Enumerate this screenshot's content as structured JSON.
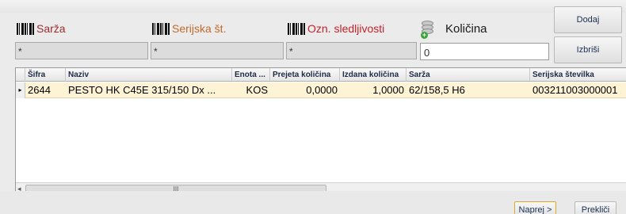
{
  "labels": {
    "sarza": "Sarža",
    "serijska": "Serijska št.",
    "ozn": "Ozn. sledljivosti",
    "kolicina": "Količina"
  },
  "filters": {
    "sarza": "*",
    "serijska": "*",
    "ozn": "*",
    "kolicina": "0"
  },
  "buttons": {
    "dodaj": "Dodaj",
    "izbrisi": "Izbriši",
    "naprej": "Naprej >",
    "preklici": "Prekliči"
  },
  "grid": {
    "columns": [
      "Šifra",
      "Naziv",
      "Enota ...",
      "Prejeta količina",
      "Izdana količina",
      "Sarža",
      "Serijska številka"
    ],
    "rows": [
      {
        "sifra": "2644",
        "naziv": "PESTO HK C45E 315/150 Dx ...",
        "enota": "KOS",
        "prejeta": "0,0000",
        "izdana": "1,0000",
        "sarza": "62/158,5 H6",
        "serijska": "003211003000001"
      }
    ],
    "scroll_thumb": "III"
  },
  "icons": {
    "barcode": "barcode-icon",
    "database": "database-add-icon",
    "row_indicator": "▸",
    "scroll_left": "◂"
  }
}
